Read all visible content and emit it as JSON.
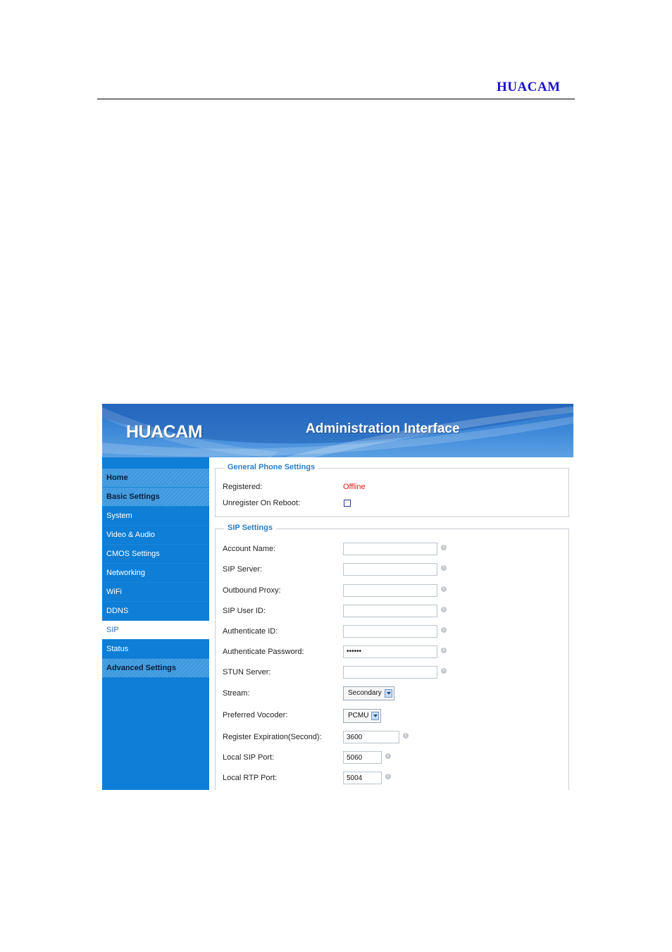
{
  "document": {
    "brand": "HUACAM"
  },
  "banner": {
    "logo": "HUACAM",
    "title": "Administration Interface"
  },
  "sidebar": {
    "items": [
      {
        "label": "Home",
        "type": "section"
      },
      {
        "label": "Basic Settings",
        "type": "section"
      },
      {
        "label": "System",
        "type": "item"
      },
      {
        "label": "Video & Audio",
        "type": "item"
      },
      {
        "label": "CMOS Settings",
        "type": "item"
      },
      {
        "label": "Networking",
        "type": "item"
      },
      {
        "label": "WiFi",
        "type": "item"
      },
      {
        "label": "DDNS",
        "type": "item"
      },
      {
        "label": "SIP",
        "type": "active"
      },
      {
        "label": "Status",
        "type": "item"
      },
      {
        "label": "Advanced Settings",
        "type": "section"
      }
    ]
  },
  "general": {
    "legend": "General Phone Settings",
    "registered_label": "Registered:",
    "registered_value": "Offline",
    "unregister_label": "Unregister On Reboot:",
    "unregister_checked": false
  },
  "sip": {
    "legend": "SIP Settings",
    "account_name_label": "Account Name:",
    "account_name_value": "",
    "sip_server_label": "SIP Server:",
    "sip_server_value": "",
    "outbound_proxy_label": "Outbound Proxy:",
    "outbound_proxy_value": "",
    "sip_user_id_label": "SIP User ID:",
    "sip_user_id_value": "",
    "authenticate_id_label": "Authenticate ID:",
    "authenticate_id_value": "",
    "authenticate_password_label": "Authenticate Password:",
    "authenticate_password_value": "••••••",
    "stun_server_label": "STUN Server:",
    "stun_server_value": "",
    "stream_label": "Stream:",
    "stream_value": "Secondary",
    "vocoder_label": "Preferred Vocoder:",
    "vocoder_value": "PCMU",
    "register_expiration_label": "Register Expiration(Second):",
    "register_expiration_value": "3600",
    "local_sip_port_label": "Local SIP Port:",
    "local_sip_port_value": "5060",
    "local_rtp_port_label": "Local RTP Port:",
    "local_rtp_port_value": "5004"
  },
  "icons": {
    "info": "info-icon",
    "dropdown": "chevron-down-icon",
    "checkbox": "checkbox-icon"
  },
  "colors": {
    "sidebar": "#0e7ed6",
    "banner": "#3c86d8",
    "legend": "#2a7fc8",
    "offline": "#e01818",
    "brand": "#1a12c8"
  }
}
